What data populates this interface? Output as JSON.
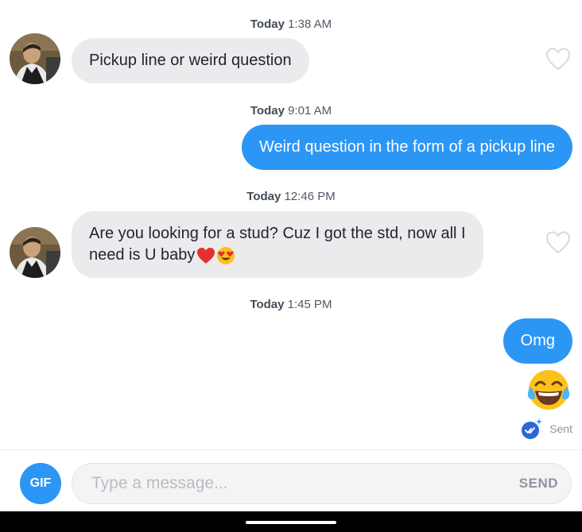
{
  "messages": [
    {
      "timestamp_day": "Today",
      "timestamp_time": "1:38 AM",
      "direction": "incoming",
      "text": "Pickup line or weird question"
    },
    {
      "timestamp_day": "Today",
      "timestamp_time": "9:01 AM",
      "direction": "outgoing",
      "text": "Weird question in the form of a pickup line"
    },
    {
      "timestamp_day": "Today",
      "timestamp_time": "12:46 PM",
      "direction": "incoming",
      "text_line1": "Are you looking for a stud? Cuz I got the std, now all I",
      "text_line2": "need is U baby",
      "emojis": [
        "red-heart",
        "heart-eyes-face"
      ]
    },
    {
      "timestamp_day": "Today",
      "timestamp_time": "1:45 PM",
      "direction": "outgoing",
      "text": "Omg",
      "emoji": "tears-of-joy-face"
    }
  ],
  "status": {
    "label": "Sent"
  },
  "composer": {
    "gif_label": "GIF",
    "placeholder": "Type a message...",
    "send_label": "SEND"
  },
  "colors": {
    "accent": "#2c96f5",
    "incoming_bubble": "#ebebed",
    "status_gray": "#8d949e"
  }
}
